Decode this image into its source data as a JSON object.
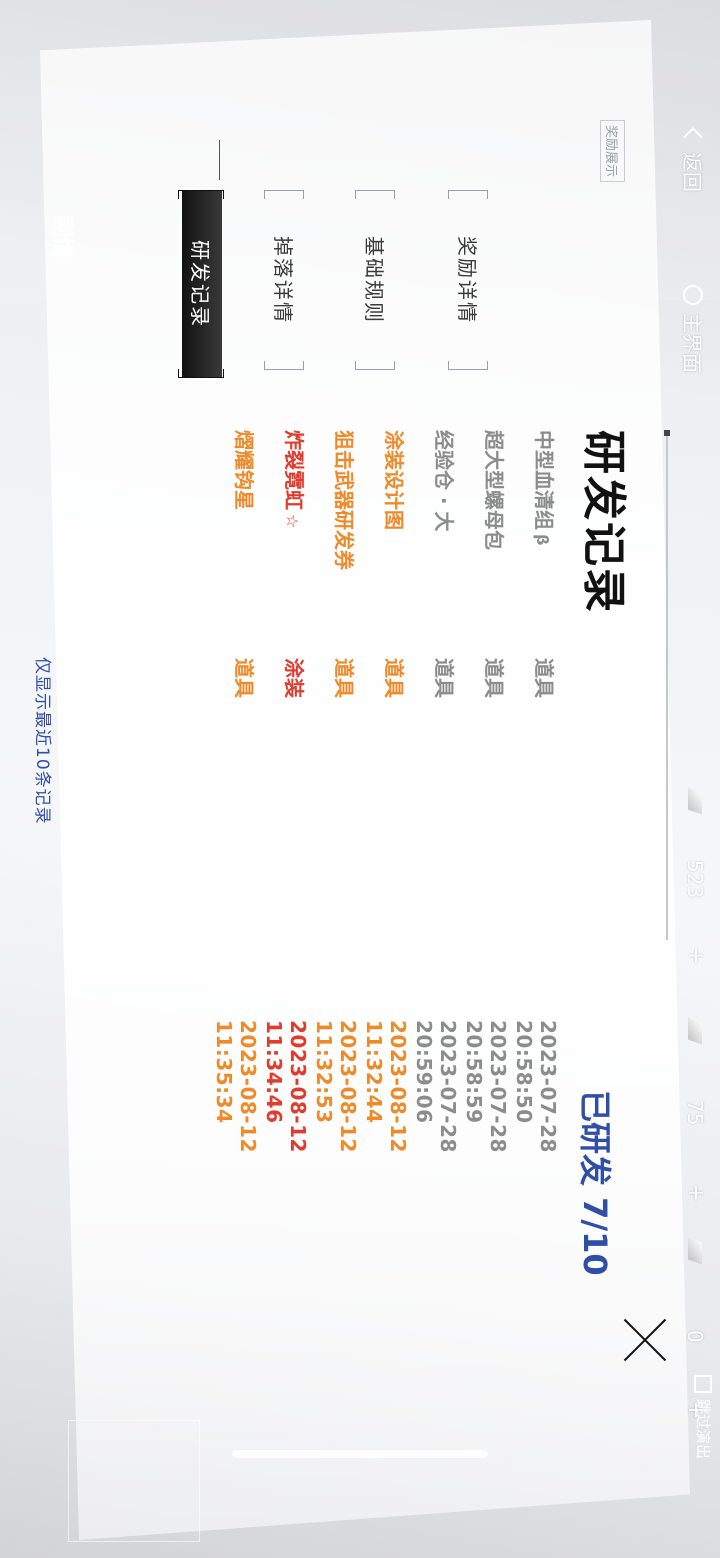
{
  "topbar": {
    "back_label": "返回",
    "home_label": "主界面",
    "resources": [
      {
        "icon": "feather-icon",
        "value": "523"
      },
      {
        "icon": "crystal-icon",
        "value": "75"
      },
      {
        "icon": "ticket-icon",
        "value": "0"
      }
    ],
    "plus": "+",
    "skip_label": "跳过演出"
  },
  "sidebar": {
    "reward_display_label": "奖励展示",
    "tabs": [
      {
        "label": "奖励详情",
        "active": false
      },
      {
        "label": "基础规则",
        "active": false
      },
      {
        "label": "掉落详情",
        "active": false
      },
      {
        "label": "研发记录",
        "active": true
      }
    ],
    "bottom_label": "剧情"
  },
  "panel": {
    "title": "研发记录",
    "progress": "已研发 7/10",
    "records": [
      {
        "name": "中型血清组",
        "suffix": "β",
        "type": "道具",
        "time": "2023-07-28 20:58:50",
        "color": "#8c8c8c"
      },
      {
        "name": "超大型螺母包",
        "suffix": "",
        "type": "道具",
        "time": "2023-07-28 20:58:59",
        "color": "#8c8c8c"
      },
      {
        "name": "经验仓 · 大",
        "suffix": "",
        "type": "道具",
        "time": "2023-07-28 20:59:06",
        "color": "#8c8c8c"
      },
      {
        "name": "涂装设计图",
        "suffix": "",
        "type": "道具",
        "time": "2023-08-12 11:32:44",
        "color": "#ef8a2a"
      },
      {
        "name": "狙击武器研发券",
        "suffix": "",
        "type": "道具",
        "time": "2023-08-12 11:32:53",
        "color": "#ef8a2a"
      },
      {
        "name": "炸裂霓虹",
        "suffix": "☆",
        "type": "涂装",
        "time": "2023-08-12 11:34:46",
        "color": "#e23a2c"
      },
      {
        "name": "熠耀钩星",
        "suffix": "",
        "type": "道具",
        "time": "2023-08-12 11:35:34",
        "color": "#ef8a2a"
      }
    ],
    "footnote": "仅显示最近10条记录"
  }
}
